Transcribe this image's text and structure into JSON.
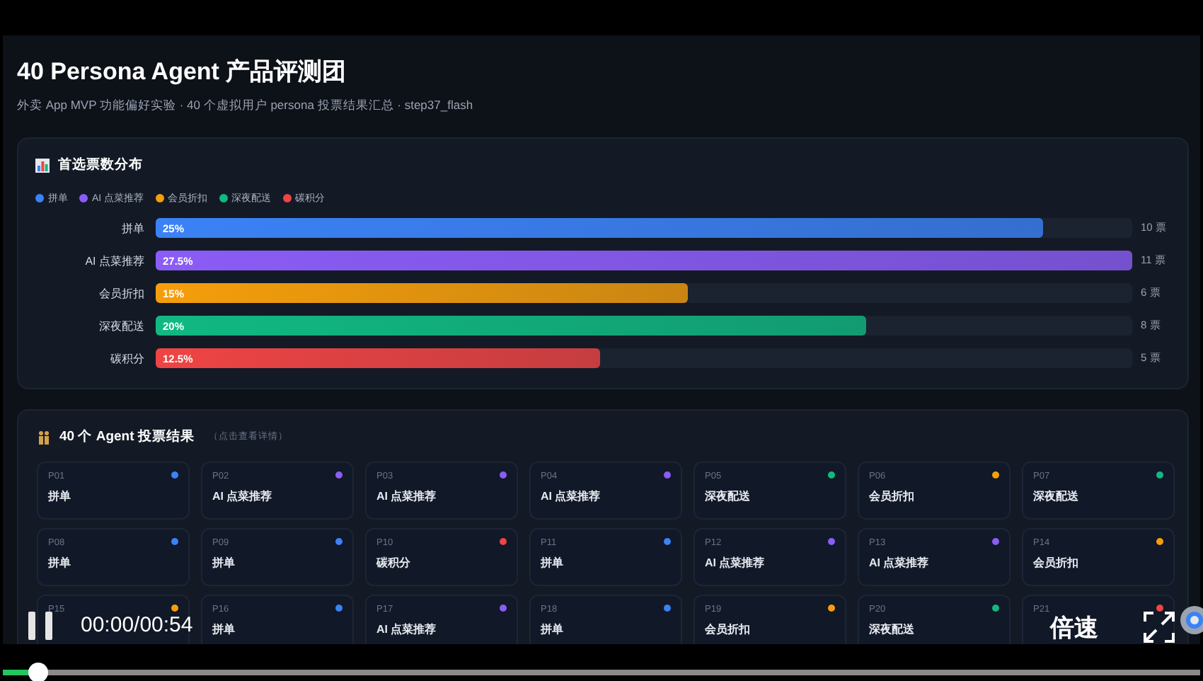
{
  "header": {
    "title": "40 Persona Agent 产品评测团",
    "subtitle": "外卖 App MVP 功能偏好实验 · 40 个虚拟用户 persona 投票结果汇总 · step37_flash"
  },
  "distribution": {
    "title": "首选票数分布",
    "legend": [
      {
        "label": "拼单",
        "color": "#3b82f6"
      },
      {
        "label": "AI 点菜推荐",
        "color": "#8b5cf6"
      },
      {
        "label": "会员折扣",
        "color": "#f59e0b"
      },
      {
        "label": "深夜配送",
        "color": "#10b981"
      },
      {
        "label": "碳积分",
        "color": "#ef4444"
      }
    ],
    "rows": [
      {
        "label": "拼单",
        "percent": "25%",
        "votes": "10 票",
        "level": 0.909,
        "color": "#3b82f6"
      },
      {
        "label": "AI 点菜推荐",
        "percent": "27.5%",
        "votes": "11 票",
        "level": 1,
        "color": "#8b5cf6"
      },
      {
        "label": "会员折扣",
        "percent": "15%",
        "votes": "6 票",
        "level": 0.545,
        "color": "#f59e0b"
      },
      {
        "label": "深夜配送",
        "percent": "20%",
        "votes": "8 票",
        "level": 0.727,
        "color": "#10b981"
      },
      {
        "label": "碳积分",
        "percent": "12.5%",
        "votes": "5 票",
        "level": 0.455,
        "color": "#ef4444"
      }
    ]
  },
  "agents": {
    "title": "40 个 Agent 投票结果",
    "hint": "（点击查看详情）",
    "cards": [
      {
        "id": "P01",
        "choice": "拼单",
        "color": "#3b82f6"
      },
      {
        "id": "P02",
        "choice": "AI 点菜推荐",
        "color": "#8b5cf6"
      },
      {
        "id": "P03",
        "choice": "AI 点菜推荐",
        "color": "#8b5cf6"
      },
      {
        "id": "P04",
        "choice": "AI 点菜推荐",
        "color": "#8b5cf6"
      },
      {
        "id": "P05",
        "choice": "深夜配送",
        "color": "#10b981"
      },
      {
        "id": "P06",
        "choice": "会员折扣",
        "color": "#f59e0b"
      },
      {
        "id": "P07",
        "choice": "深夜配送",
        "color": "#10b981"
      },
      {
        "id": "P08",
        "choice": "拼单",
        "color": "#3b82f6"
      },
      {
        "id": "P09",
        "choice": "拼单",
        "color": "#3b82f6"
      },
      {
        "id": "P10",
        "choice": "碳积分",
        "color": "#ef4444"
      },
      {
        "id": "P11",
        "choice": "拼单",
        "color": "#3b82f6"
      },
      {
        "id": "P12",
        "choice": "AI 点菜推荐",
        "color": "#8b5cf6"
      },
      {
        "id": "P13",
        "choice": "AI 点菜推荐",
        "color": "#8b5cf6"
      },
      {
        "id": "P14",
        "choice": "会员折扣",
        "color": "#f59e0b"
      },
      {
        "id": "P15",
        "color": "#f59e0b"
      },
      {
        "id": "P16",
        "choice": "拼单",
        "color": "#3b82f6"
      },
      {
        "id": "P17",
        "choice": "AI 点菜推荐",
        "color": "#8b5cf6"
      },
      {
        "id": "P18",
        "choice": "拼单",
        "color": "#3b82f6"
      },
      {
        "id": "P19",
        "choice": "会员折扣",
        "color": "#f59e0b"
      },
      {
        "id": "P20",
        "choice": "深夜配送",
        "color": "#10b981"
      },
      {
        "id": "P21",
        "color": "#ef4444"
      }
    ]
  },
  "player": {
    "playing": true,
    "time": "00:00/00:54",
    "speed": "倍速",
    "level": 0.03
  }
}
